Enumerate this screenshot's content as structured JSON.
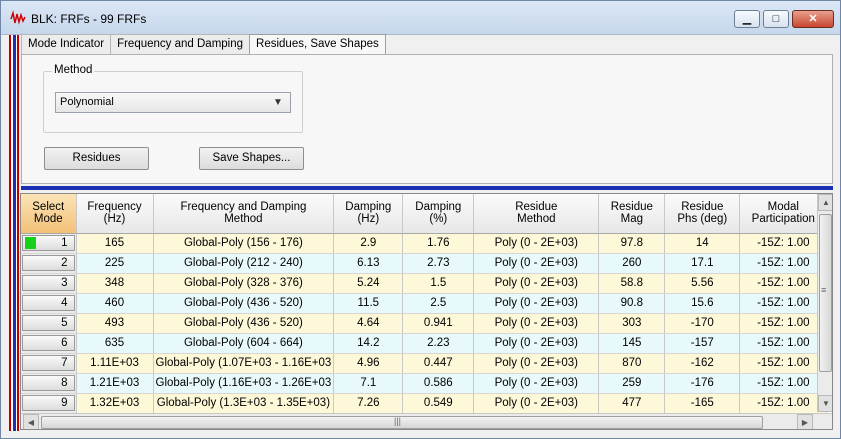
{
  "window": {
    "title": "BLK: FRFs - 99 FRFs",
    "minimize": "▁",
    "maximize": "□",
    "close": "✕"
  },
  "tabs": [
    "Mode Indicator",
    "Frequency and Damping",
    "Residues, Save Shapes"
  ],
  "method": {
    "label": "Method",
    "value": "Polynomial"
  },
  "buttons": {
    "residues": "Residues",
    "save_shapes": "Save Shapes..."
  },
  "grid": {
    "headers": [
      "Select\nMode",
      "Frequency\n(Hz)",
      "Frequency and Damping\nMethod",
      "Damping\n(Hz)",
      "Damping\n(%)",
      "Residue\nMethod",
      "Residue\nMag",
      "Residue\nPhs (deg)",
      "Modal\nParticipation"
    ],
    "rows": [
      [
        "1",
        "165",
        "Global-Poly (156 - 176)",
        "2.9",
        "1.76",
        "Poly (0 - 2E+03)",
        "97.8",
        "14",
        "-15Z: 1.00"
      ],
      [
        "2",
        "225",
        "Global-Poly (212 - 240)",
        "6.13",
        "2.73",
        "Poly (0 - 2E+03)",
        "260",
        "17.1",
        "-15Z: 1.00"
      ],
      [
        "3",
        "348",
        "Global-Poly (328 - 376)",
        "5.24",
        "1.5",
        "Poly (0 - 2E+03)",
        "58.8",
        "5.56",
        "-15Z: 1.00"
      ],
      [
        "4",
        "460",
        "Global-Poly (436 - 520)",
        "11.5",
        "2.5",
        "Poly (0 - 2E+03)",
        "90.8",
        "15.6",
        "-15Z: 1.00"
      ],
      [
        "5",
        "493",
        "Global-Poly (436 - 520)",
        "4.64",
        "0.941",
        "Poly (0 - 2E+03)",
        "303",
        "-170",
        "-15Z: 1.00"
      ],
      [
        "6",
        "635",
        "Global-Poly (604 - 664)",
        "14.2",
        "2.23",
        "Poly (0 - 2E+03)",
        "145",
        "-157",
        "-15Z: 1.00"
      ],
      [
        "7",
        "1.11E+03",
        "Global-Poly (1.07E+03 - 1.16E+03",
        "4.96",
        "0.447",
        "Poly (0 - 2E+03)",
        "870",
        "-162",
        "-15Z: 1.00"
      ],
      [
        "8",
        "1.21E+03",
        "Global-Poly (1.16E+03 - 1.26E+03",
        "7.1",
        "0.586",
        "Poly (0 - 2E+03)",
        "259",
        "-176",
        "-15Z: 1.00"
      ],
      [
        "9",
        "1.32E+03",
        "Global-Poly (1.3E+03 - 1.35E+03)",
        "7.26",
        "0.549",
        "Poly (0 - 2E+03)",
        "477",
        "-165",
        "-15Z: 1.00"
      ]
    ],
    "selected_row": 0,
    "scroll_icons": {
      "up": "▲",
      "down": "▼",
      "left": "◀",
      "right": "▶",
      "grip_v": "≡",
      "grip_h": "|||"
    }
  }
}
